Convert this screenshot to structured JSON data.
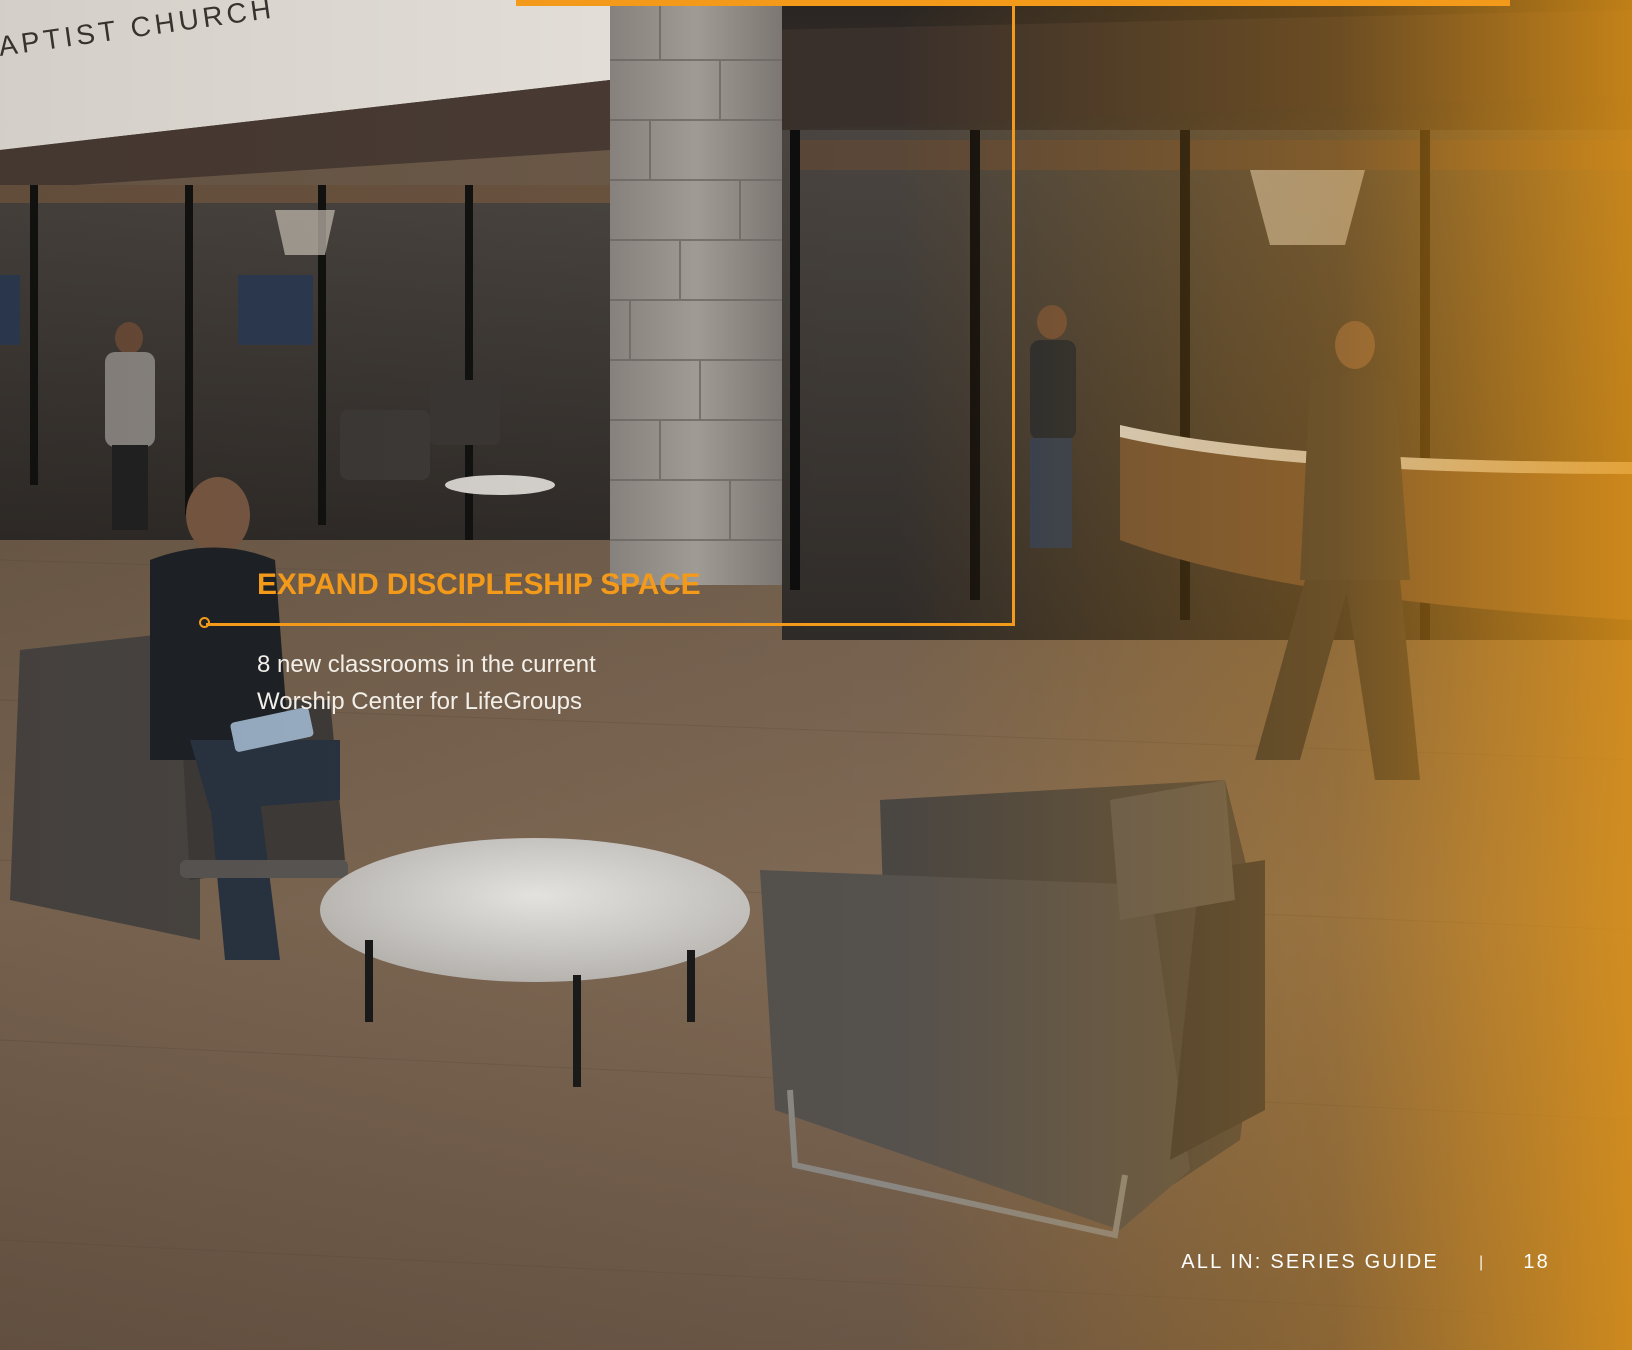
{
  "background": {
    "sign_text": "APTIST CHURCH",
    "colors": {
      "accent": "#f39a1a",
      "floor": "#7d6650",
      "wall": "#2b2622",
      "stone": "#8f8a84",
      "chair": "#4e4a46",
      "table": "#d8d6d2",
      "text_light": "#f2efe9"
    }
  },
  "callout": {
    "title": "EXPAND DISCIPLESHIP SPACE",
    "body_line1": "8 new classrooms in the current",
    "body_line2": "Worship Center for LifeGroups"
  },
  "footer": {
    "guide_label": "ALL IN: SERIES GUIDE",
    "separator": "|",
    "page_number": "18"
  }
}
